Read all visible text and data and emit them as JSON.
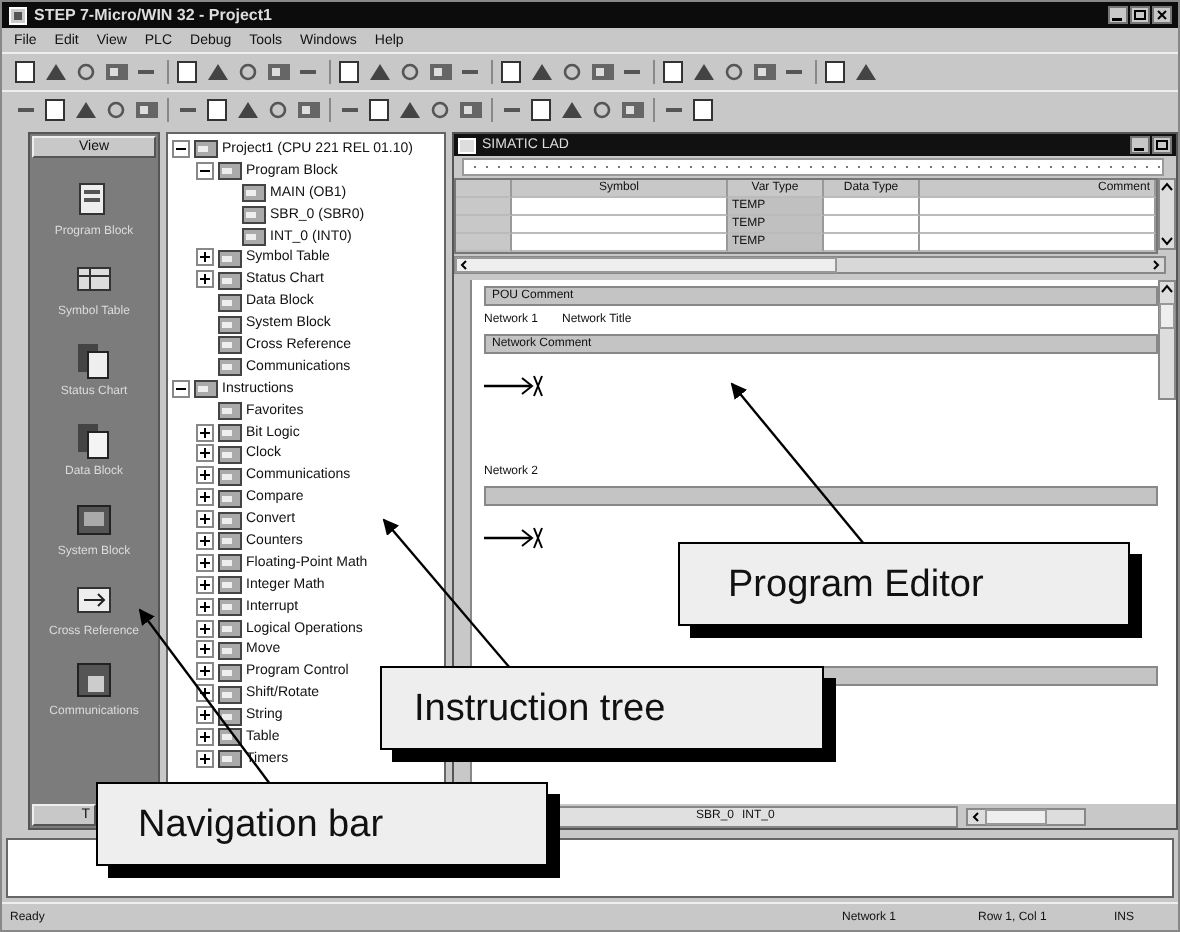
{
  "window": {
    "title": "STEP 7-Micro/WIN 32 - Project1"
  },
  "menu": [
    "File",
    "Edit",
    "View",
    "PLC",
    "Debug",
    "Tools",
    "Windows",
    "Help"
  ],
  "nav_bar": {
    "header": "View",
    "items": [
      {
        "label": "Program Block"
      },
      {
        "label": "Symbol Table"
      },
      {
        "label": "Status Chart"
      },
      {
        "label": "Data Block"
      },
      {
        "label": "System Block"
      },
      {
        "label": "Cross Reference"
      },
      {
        "label": "Communications"
      }
    ],
    "footer": "T"
  },
  "tree": [
    {
      "label": "Project1 (CPU 221 REL 01.10)",
      "expanded": true,
      "children": [
        {
          "label": "Program Block",
          "expanded": true,
          "children": [
            {
              "label": "MAIN (OB1)"
            },
            {
              "label": "SBR_0 (SBR0)"
            },
            {
              "label": "INT_0 (INT0)"
            }
          ]
        },
        {
          "label": "Symbol Table",
          "expanded": false
        },
        {
          "label": "Status Chart",
          "expanded": false
        },
        {
          "label": "Data Block"
        },
        {
          "label": "System Block"
        },
        {
          "label": "Cross Reference"
        },
        {
          "label": "Communications"
        }
      ]
    },
    {
      "label": "Instructions",
      "expanded": true,
      "children": [
        {
          "label": "Favorites"
        },
        {
          "label": "Bit Logic",
          "expanded": false
        },
        {
          "label": "Clock",
          "expanded": false
        },
        {
          "label": "Communications",
          "expanded": false
        },
        {
          "label": "Compare",
          "expanded": false
        },
        {
          "label": "Convert",
          "expanded": false
        },
        {
          "label": "Counters",
          "expanded": false
        },
        {
          "label": "Floating-Point Math",
          "expanded": false
        },
        {
          "label": "Integer Math",
          "expanded": false
        },
        {
          "label": "Interrupt",
          "expanded": false
        },
        {
          "label": "Logical Operations",
          "expanded": false
        },
        {
          "label": "Move",
          "expanded": false
        },
        {
          "label": "Program Control",
          "expanded": false
        },
        {
          "label": "Shift/Rotate",
          "expanded": false
        },
        {
          "label": "String",
          "expanded": false
        },
        {
          "label": "Table",
          "expanded": false
        },
        {
          "label": "Timers",
          "expanded": false
        }
      ]
    }
  ],
  "editor": {
    "title": "SIMATIC LAD",
    "var_table": {
      "columns": [
        "Symbol",
        "Var Type",
        "Data Type",
        "Comment"
      ],
      "rows": [
        [
          "",
          "TEMP",
          "",
          ""
        ],
        [
          "",
          "TEMP",
          "",
          ""
        ],
        [
          "",
          "TEMP",
          "",
          ""
        ]
      ]
    },
    "pou_comment": "POU Comment",
    "networks": [
      {
        "number": "Network 1",
        "title": "Network Title",
        "comment": "Network Comment"
      },
      {
        "number": "Network 2"
      }
    ],
    "tabs": [
      {
        "label": "SBR_0",
        "selected": false
      },
      {
        "label": "INT_0",
        "selected": false
      }
    ]
  },
  "status_bar": [
    "Ready",
    "Network 1",
    "Row 1, Col 1",
    "INS"
  ],
  "callouts": [
    {
      "text": "Program Editor"
    },
    {
      "text": "Instruction tree"
    },
    {
      "text": "Navigation bar"
    }
  ]
}
